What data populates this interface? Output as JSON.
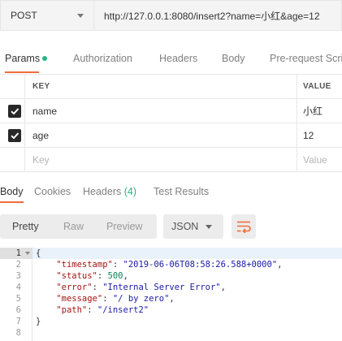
{
  "request": {
    "method": "POST",
    "url": "http://127.0.0.1:8080/insert2?name=小红&age=12"
  },
  "request_tabs": [
    {
      "label": "Params",
      "active": true
    },
    {
      "label": "Authorization"
    },
    {
      "label": "Headers"
    },
    {
      "label": "Body"
    },
    {
      "label": "Pre-request Scri"
    }
  ],
  "params_table": {
    "headers": {
      "key": "KEY",
      "value": "VALUE"
    },
    "rows": [
      {
        "checked": true,
        "key": "name",
        "value": "小红"
      },
      {
        "checked": true,
        "key": "age",
        "value": "12"
      }
    ],
    "placeholder": {
      "key": "Key",
      "value": "Value"
    }
  },
  "response_tabs": {
    "body": "Body",
    "cookies": "Cookies",
    "headers": "Headers",
    "headers_count": "(4)",
    "test_results": "Test Results"
  },
  "toolbar": {
    "pretty": "Pretty",
    "raw": "Raw",
    "preview": "Preview",
    "format": "JSON"
  },
  "response_body": {
    "line_numbers": [
      "1",
      "2",
      "3",
      "4",
      "5",
      "6",
      "7",
      "8"
    ],
    "open_brace": "{",
    "close_brace": "}",
    "fields": [
      {
        "key": "\"timestamp\"",
        "value": "\"2019-06-06T08:58:26.588+0000\"",
        "kind": "s",
        "comma": ","
      },
      {
        "key": "\"status\"",
        "value": "500",
        "kind": "n",
        "comma": ","
      },
      {
        "key": "\"error\"",
        "value": "\"Internal Server Error\"",
        "kind": "s",
        "comma": ","
      },
      {
        "key": "\"message\"",
        "value": "\"/ by zero\"",
        "kind": "s",
        "comma": ","
      },
      {
        "key": "\"path\"",
        "value": "\"/insert2\"",
        "kind": "s",
        "comma": ""
      }
    ]
  },
  "colors": {
    "accent": "#f26b3a",
    "active_dot": "#26b47f",
    "json_key": "#a31515",
    "json_string": "#1a1aa6",
    "json_number": "#098658"
  }
}
